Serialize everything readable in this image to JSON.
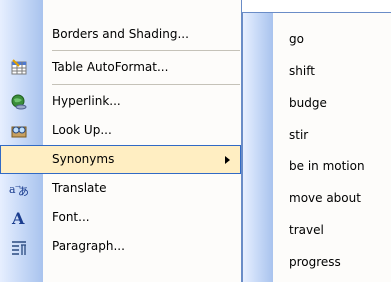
{
  "context_menu": {
    "items": [
      {
        "label": "Borders and Shading...",
        "icon": "borders-icon"
      },
      {
        "label": "Table AutoFormat...",
        "icon": "table-autoformat-icon"
      },
      {
        "label": "Hyperlink...",
        "icon": "hyperlink-icon"
      },
      {
        "label": "Look Up...",
        "icon": "lookup-icon"
      },
      {
        "label": "Synonyms",
        "icon": "",
        "has_submenu": true
      },
      {
        "label": "Translate",
        "icon": "translate-icon"
      },
      {
        "label": "Font...",
        "icon": "font-icon"
      },
      {
        "label": "Paragraph...",
        "icon": "paragraph-icon"
      }
    ]
  },
  "synonyms_submenu": {
    "items": [
      "go",
      "shift",
      "budge",
      "stir",
      "be in motion",
      "move about",
      "travel",
      "progress"
    ]
  },
  "colors": {
    "highlight_bg": "#ffeec2",
    "highlight_border": "#316ac5",
    "gutter_blue": "#a9c3ee"
  }
}
